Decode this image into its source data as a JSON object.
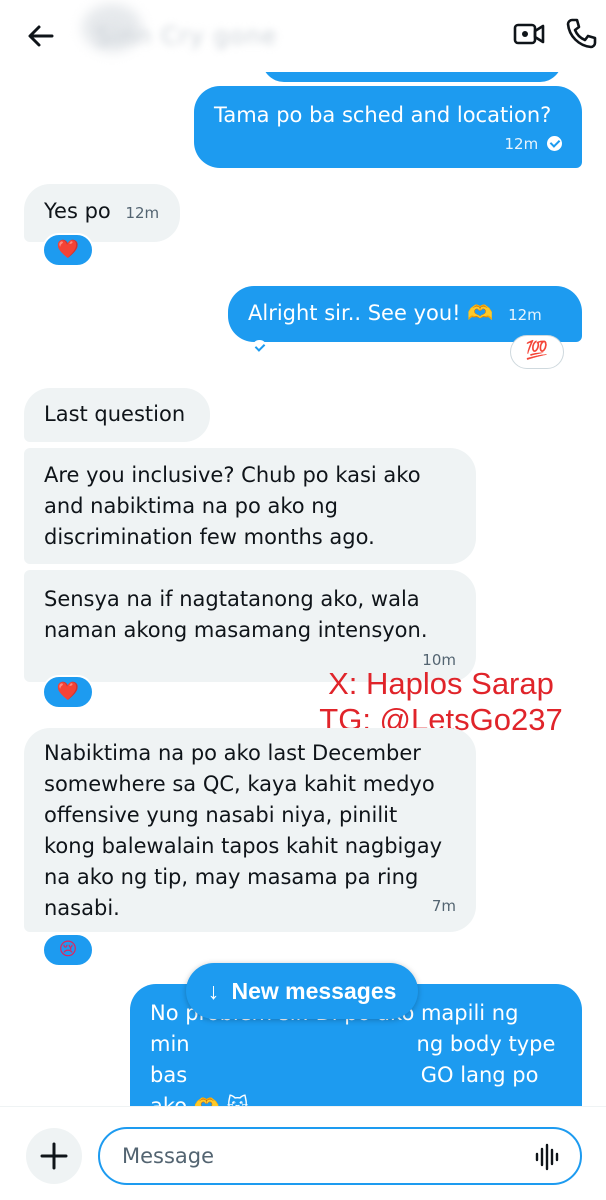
{
  "header": {
    "contact_name": "Sinn Cry gone",
    "icons": {
      "back": "arrow-left-icon",
      "video": "video-call-icon",
      "call": "phone-icon"
    }
  },
  "messages": [
    {
      "id": "m1",
      "side": "sent",
      "text": "Tama po ba sched and location?",
      "time": "12m",
      "seen": true
    },
    {
      "id": "m2",
      "side": "received",
      "text": "Yes po",
      "time": "12m",
      "reaction": "❤️"
    },
    {
      "id": "m3",
      "side": "sent",
      "text": "Alright sir.. See you! 🫶",
      "time": "12m",
      "seen": true,
      "reaction": "💯"
    },
    {
      "id": "m4",
      "side": "received",
      "text": "Last question"
    },
    {
      "id": "m5",
      "side": "received",
      "lines": [
        "Are you inclusive? Chub po kasi ako",
        "and nabiktima na po ako ng",
        "discrimination few months ago."
      ]
    },
    {
      "id": "m6",
      "side": "received",
      "lines": [
        "Sensya na if nagtatanong ako,  wala",
        "naman akong masamang intensyon."
      ],
      "time": "10m",
      "reaction": "❤️"
    },
    {
      "id": "m7",
      "side": "received",
      "lines": [
        "Nabiktima na po ako last December",
        "somewhere sa QC, kaya kahit medyo",
        "offensive yung nasabi niya, pinilit",
        "kong balewalain tapos kahit nagbigay",
        "na ako ng tip, may masama pa ring",
        "nasabi."
      ],
      "time": "7m",
      "reaction": "😢"
    },
    {
      "id": "m8",
      "side": "sent",
      "lines": [
        "No problem sir. Di po ako mapili ng",
        "min                                  ng body type",
        "bas                                   GO lang po",
        "ako 🫶 😺"
      ]
    }
  ],
  "watermark": {
    "line1": "X: Haplos Sarap",
    "line2": "TG: @LetsGo237"
  },
  "new_messages": {
    "label": "New messages",
    "arrow": "↓"
  },
  "composer": {
    "placeholder": "Message",
    "icons": {
      "add": "plus-icon",
      "voice": "voice-waveform-icon"
    }
  },
  "colors": {
    "accent": "#1d9bf0",
    "received_bubble": "#eff3f4",
    "watermark": "#e0242a"
  }
}
